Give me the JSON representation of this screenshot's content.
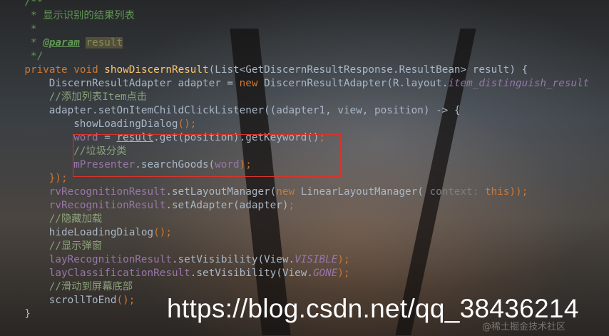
{
  "code_lines": [
    {
      "indent": 4,
      "tokens": [
        {
          "t": "/**",
          "c": "doc"
        }
      ]
    },
    {
      "indent": 4,
      "tokens": [
        {
          "t": " * 显示识别的结果列表",
          "c": "doc"
        }
      ]
    },
    {
      "indent": 4,
      "tokens": [
        {
          "t": " *",
          "c": "doc"
        }
      ]
    },
    {
      "indent": 4,
      "tokens": [
        {
          "t": " * ",
          "c": "doc"
        },
        {
          "t": "@param",
          "c": "tag"
        },
        {
          "t": " ",
          "c": "doc"
        },
        {
          "t": "result",
          "c": "param-bg"
        }
      ]
    },
    {
      "indent": 4,
      "tokens": [
        {
          "t": " */",
          "c": "doc"
        }
      ]
    },
    {
      "indent": 4,
      "tokens": [
        {
          "t": "private void ",
          "c": "kw"
        },
        {
          "t": "showDiscernResult",
          "c": "fn"
        },
        {
          "t": "(List<GetDiscernResultResponse.ResultBean> result) {",
          "c": "ink"
        }
      ]
    },
    {
      "indent": 8,
      "tokens": [
        {
          "t": "DiscernResultAdapter adapter = ",
          "c": "ink"
        },
        {
          "t": "new ",
          "c": "kw"
        },
        {
          "t": "DiscernResultAdapter(R.layout.",
          "c": "ink"
        },
        {
          "t": "item_distinguish_result",
          "c": "fld ital"
        }
      ]
    },
    {
      "indent": 8,
      "tokens": [
        {
          "t": "//添加列表Item点击",
          "c": "cm"
        }
      ]
    },
    {
      "indent": 8,
      "tokens": [
        {
          "t": "adapter.setOnItemChildClickListener((adapter1, view, position) -> {",
          "c": "ink"
        }
      ]
    },
    {
      "indent": 12,
      "tokens": [
        {
          "t": "showLoadingDialog",
          "c": "ink"
        },
        {
          "t": "();",
          "c": "kw"
        }
      ]
    },
    {
      "indent": 12,
      "tokens": [
        {
          "t": "word",
          "c": "fld"
        },
        {
          "t": " = ",
          "c": "ink"
        },
        {
          "t": "result",
          "c": "ink ul"
        },
        {
          "t": ".get(position).getKeyword()",
          "c": "ink"
        },
        {
          "t": ";",
          "c": "kw"
        }
      ]
    },
    {
      "indent": 12,
      "tokens": [
        {
          "t": "//垃圾分类",
          "c": "cm"
        }
      ]
    },
    {
      "indent": 12,
      "tokens": [
        {
          "t": "mPresenter",
          "c": "fld"
        },
        {
          "t": ".searchGoods(",
          "c": "ink"
        },
        {
          "t": "word",
          "c": "fld"
        },
        {
          "t": ");",
          "c": "kw"
        }
      ]
    },
    {
      "indent": 8,
      "tokens": [
        {
          "t": "});",
          "c": "kw"
        }
      ]
    },
    {
      "indent": 8,
      "tokens": [
        {
          "t": "rvRecognitionResult",
          "c": "fld"
        },
        {
          "t": ".setLayoutManager(",
          "c": "ink"
        },
        {
          "t": "new ",
          "c": "kw"
        },
        {
          "t": "LinearLayoutManager(",
          "c": "ink"
        },
        {
          "t": " context: ",
          "c": "hint"
        },
        {
          "t": "this",
          "c": "kw"
        },
        {
          "t": "));",
          "c": "kw"
        }
      ]
    },
    {
      "indent": 8,
      "tokens": [
        {
          "t": "rvRecognitionResult",
          "c": "fld"
        },
        {
          "t": ".setAdapter(adapter)",
          "c": "ink"
        },
        {
          "t": ";",
          "c": "kw"
        }
      ]
    },
    {
      "indent": 8,
      "tokens": [
        {
          "t": "//隐藏加载",
          "c": "cm"
        }
      ]
    },
    {
      "indent": 8,
      "tokens": [
        {
          "t": "hideLoadingDialog",
          "c": "ink"
        },
        {
          "t": "();",
          "c": "kw"
        }
      ]
    },
    {
      "indent": 8,
      "tokens": [
        {
          "t": "//显示弹窗",
          "c": "cm"
        }
      ]
    },
    {
      "indent": 8,
      "tokens": [
        {
          "t": "layRecognitionResult",
          "c": "fld"
        },
        {
          "t": ".setVisibility(View.",
          "c": "ink"
        },
        {
          "t": "VISIBLE",
          "c": "fld ital"
        },
        {
          "t": ");",
          "c": "kw"
        }
      ]
    },
    {
      "indent": 8,
      "tokens": [
        {
          "t": "layClassificationResult",
          "c": "fld"
        },
        {
          "t": ".setVisibility(View.",
          "c": "ink"
        },
        {
          "t": "GONE",
          "c": "fld ital"
        },
        {
          "t": ");",
          "c": "kw"
        }
      ]
    },
    {
      "indent": 8,
      "tokens": [
        {
          "t": "//滑动到屏幕底部",
          "c": "cm"
        }
      ]
    },
    {
      "indent": 8,
      "tokens": [
        {
          "t": "scrollToEnd",
          "c": "ink"
        },
        {
          "t": "();",
          "c": "kw"
        }
      ]
    },
    {
      "indent": 4,
      "tokens": [
        {
          "t": "}",
          "c": "ink"
        }
      ]
    }
  ],
  "watermark": {
    "url": "https://blog.csdn.net/qq_38436214",
    "community": "@稀土掘金技术社区"
  },
  "colors": {
    "keyword": "#cc7832",
    "method": "#ffc66d",
    "field": "#9876aa",
    "comment": "#8aa17a",
    "default": "#a9b7c6",
    "highlight_border": "#d9342b"
  }
}
